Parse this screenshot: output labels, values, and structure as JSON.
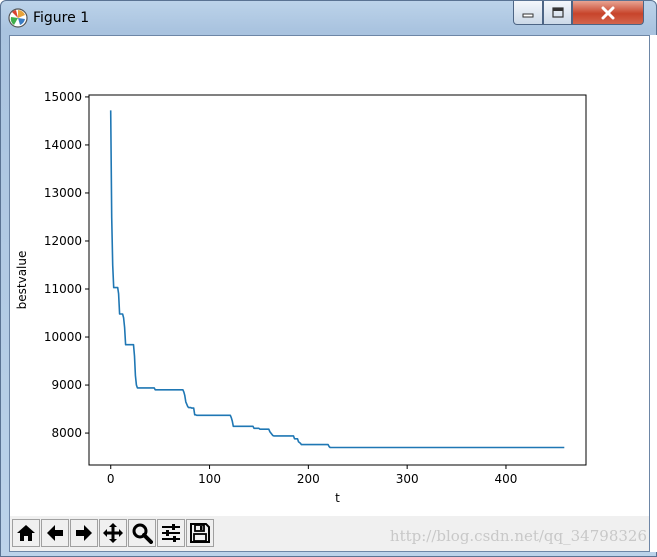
{
  "window": {
    "title": "Figure 1",
    "buttons": {
      "minimize": "minimize",
      "maximize": "maximize",
      "close": "close"
    }
  },
  "toolbar": {
    "icons": [
      "home-icon",
      "back-icon",
      "forward-icon",
      "pan-icon",
      "zoom-icon",
      "configure-subplots-icon",
      "save-icon"
    ]
  },
  "watermark": "http://blog.csdn.net/qq_34798326",
  "chart_data": {
    "type": "line",
    "title": "",
    "xlabel": "t",
    "ylabel": "bestvalue",
    "xlim": [
      -22,
      481
    ],
    "ylim": [
      7335,
      15040
    ],
    "xticks": [
      0,
      100,
      200,
      300,
      400
    ],
    "yticks": [
      8000,
      9000,
      10000,
      11000,
      12000,
      13000,
      14000,
      15000
    ],
    "grid": false,
    "color": "#1f77b4",
    "series": [
      {
        "x": [
          0,
          1,
          2,
          3,
          4,
          7,
          8,
          9,
          10,
          11,
          12,
          13,
          14,
          15,
          16,
          21,
          22,
          23,
          24,
          25,
          26,
          27,
          28,
          29,
          30,
          44,
          45,
          73,
          74,
          75,
          76,
          77,
          78,
          79,
          80,
          81,
          82,
          83,
          84,
          85,
          86,
          87,
          121,
          122,
          123,
          124,
          125,
          126,
          144,
          145,
          150,
          151,
          160,
          161,
          164,
          165,
          166,
          167,
          185,
          186,
          189,
          190,
          192,
          193,
          194,
          195,
          196,
          197,
          198,
          199,
          200,
          220,
          221,
          222,
          459
        ],
        "y": [
          14720,
          12500,
          11500,
          11030,
          11030,
          11030,
          10900,
          10480,
          10480,
          10480,
          10480,
          10400,
          10200,
          9840,
          9840,
          9840,
          9840,
          9840,
          9600,
          9200,
          9000,
          8940,
          8940,
          8940,
          8940,
          8940,
          8900,
          8900,
          8850,
          8780,
          8650,
          8600,
          8550,
          8530,
          8530,
          8530,
          8520,
          8520,
          8520,
          8380,
          8380,
          8370,
          8370,
          8320,
          8250,
          8140,
          8140,
          8140,
          8140,
          8100,
          8100,
          8080,
          8080,
          8030,
          7950,
          7940,
          7940,
          7940,
          7940,
          7880,
          7880,
          7820,
          7790,
          7760,
          7760,
          7760,
          7760,
          7760,
          7760,
          7760,
          7760,
          7760,
          7720,
          7700,
          7700
        ]
      }
    ]
  }
}
